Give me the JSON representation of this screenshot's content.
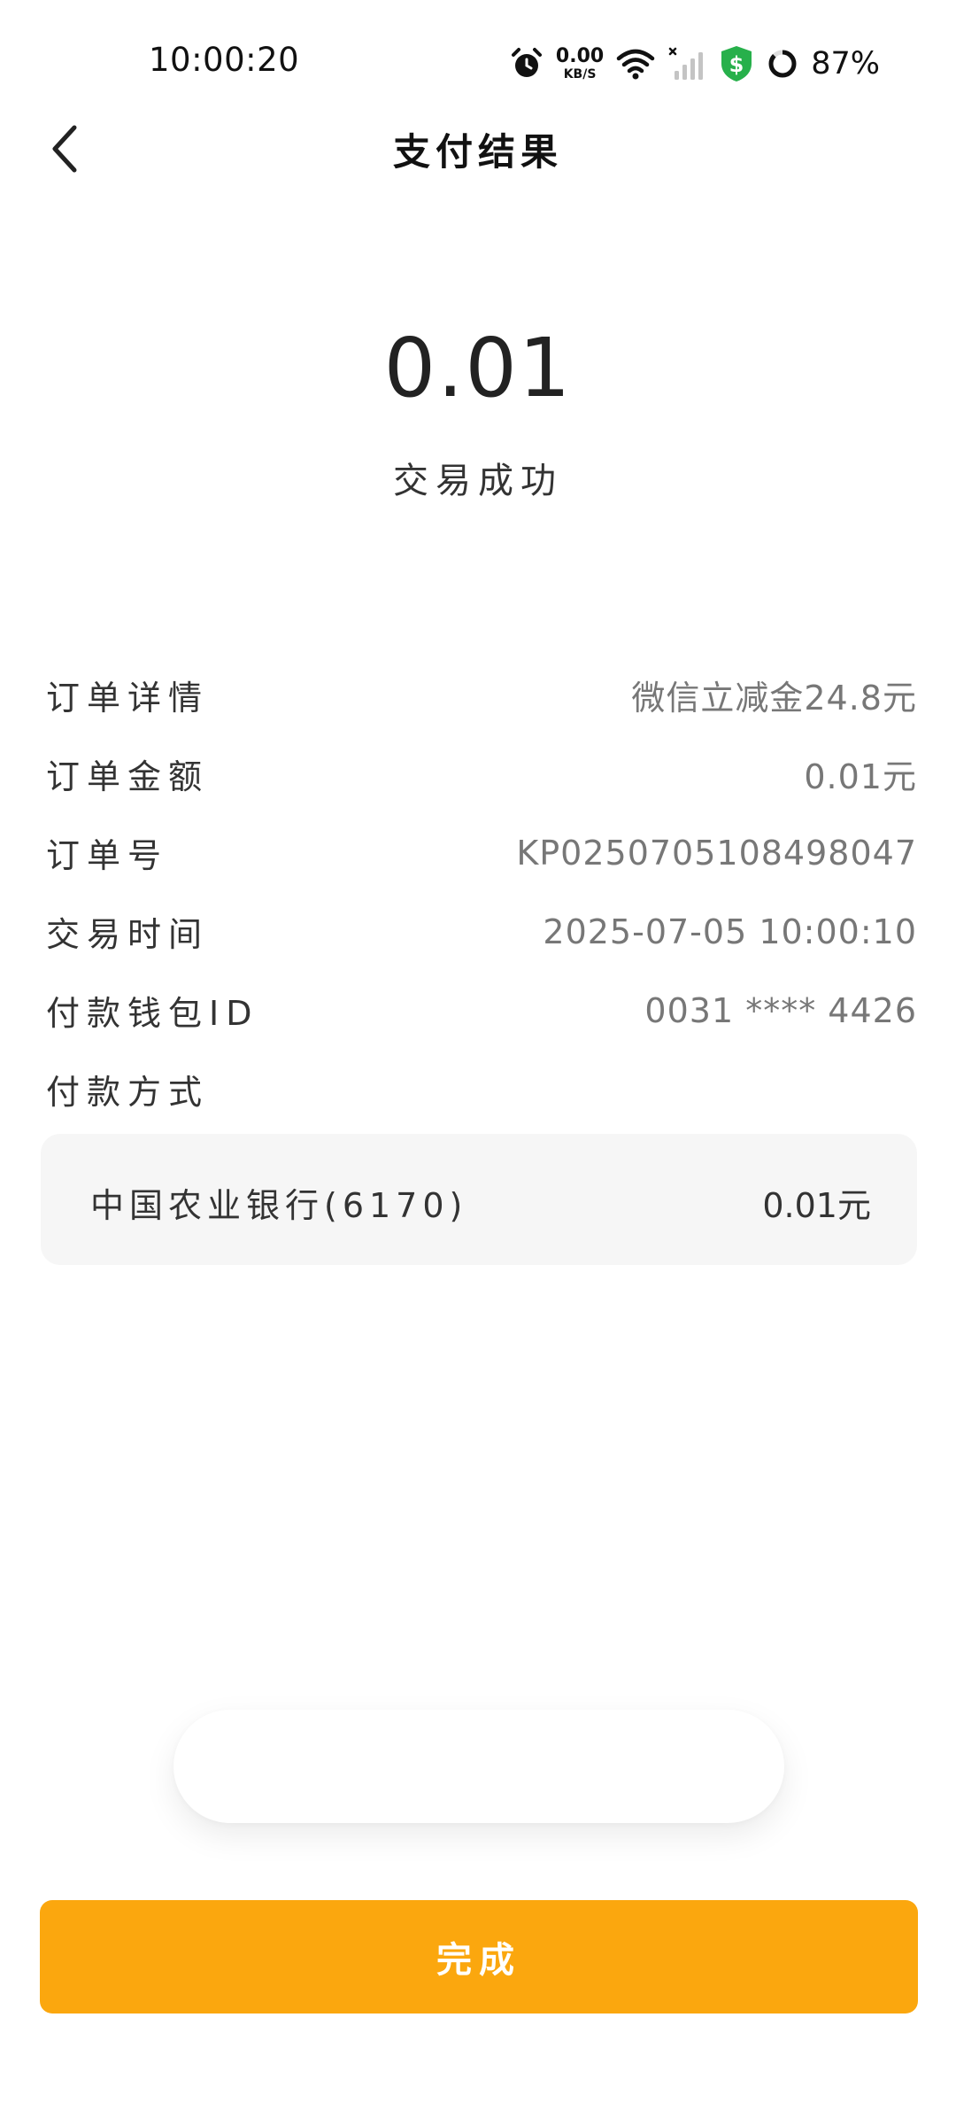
{
  "status_bar": {
    "time": "10:00:20",
    "net_speed_value": "0.00",
    "net_speed_unit": "KB/S",
    "battery": "87%",
    "icons": [
      "alarm-icon",
      "wifi-icon",
      "cellular-signal-icon",
      "security-shield-icon",
      "battery-ring-icon"
    ]
  },
  "header": {
    "title": "支付结果",
    "back_icon": "chevron-left-icon"
  },
  "result": {
    "amount": "0.01",
    "status": "交易成功"
  },
  "details": [
    {
      "label": "订单详情",
      "value": "微信立减金24.8元"
    },
    {
      "label": "订单金额",
      "value": "0.01元"
    },
    {
      "label": "订单号",
      "value": "KP0250705108498047"
    },
    {
      "label": "交易时间",
      "value": "2025-07-05 10:00:10"
    },
    {
      "label": "付款钱包ID",
      "value": "0031 **** 4426"
    },
    {
      "label": "付款方式",
      "value": ""
    }
  ],
  "payment_method": {
    "bank": "中国农业银行(6170)",
    "amount": "0.01元"
  },
  "footer": {
    "done_label": "完成"
  },
  "colors": {
    "accent": "#fba70e",
    "pay_box_bg": "#f6f6f6",
    "shield_green": "#27b04b"
  }
}
